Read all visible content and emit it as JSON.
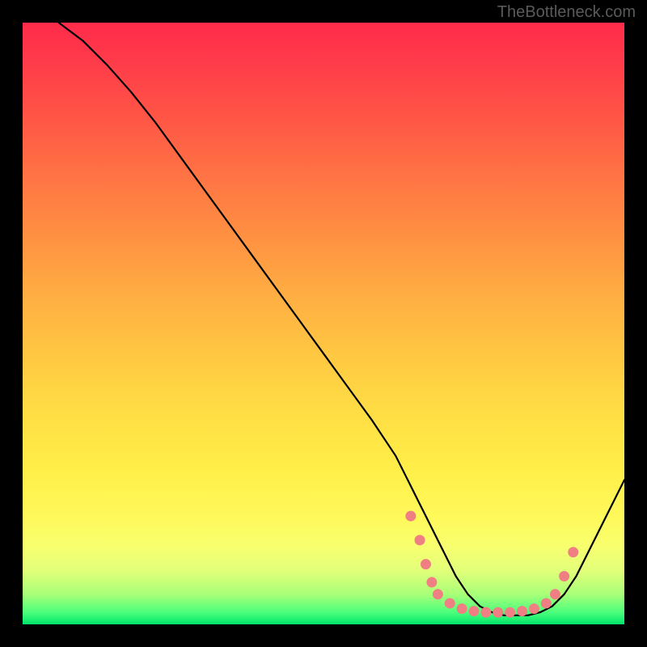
{
  "attribution": "TheBottleneck.com",
  "chart_data": {
    "type": "line",
    "title": "",
    "xlabel": "",
    "ylabel": "",
    "xlim": [
      0,
      100
    ],
    "ylim": [
      0,
      100
    ],
    "series": [
      {
        "name": "bottleneck-curve",
        "x": [
          6,
          10,
          14,
          18,
          22,
          26,
          30,
          34,
          38,
          42,
          46,
          50,
          54,
          58,
          62,
          64,
          66,
          68,
          70,
          72,
          74,
          76,
          78,
          80,
          82,
          84,
          86,
          88,
          90,
          92,
          94,
          96,
          98,
          100
        ],
        "y": [
          100,
          97,
          93,
          88.5,
          83.5,
          78,
          72.5,
          67,
          61.5,
          56,
          50.5,
          45,
          39.5,
          34,
          28,
          24,
          20,
          16,
          12,
          8,
          5,
          3,
          2,
          1.5,
          1.5,
          1.5,
          2,
          3,
          5,
          8,
          12,
          16,
          20,
          24
        ]
      }
    ],
    "markers": {
      "name": "highlight-points",
      "color": "#ef7f83",
      "points": [
        {
          "x": 64.5,
          "y": 18
        },
        {
          "x": 66,
          "y": 14
        },
        {
          "x": 67,
          "y": 10
        },
        {
          "x": 68,
          "y": 7
        },
        {
          "x": 69,
          "y": 5
        },
        {
          "x": 71,
          "y": 3.5
        },
        {
          "x": 73,
          "y": 2.6
        },
        {
          "x": 75,
          "y": 2.2
        },
        {
          "x": 77,
          "y": 2
        },
        {
          "x": 79,
          "y": 2
        },
        {
          "x": 81,
          "y": 2
        },
        {
          "x": 83,
          "y": 2.2
        },
        {
          "x": 85,
          "y": 2.6
        },
        {
          "x": 87,
          "y": 3.5
        },
        {
          "x": 88.5,
          "y": 5
        },
        {
          "x": 90,
          "y": 8
        },
        {
          "x": 91.5,
          "y": 12
        }
      ]
    }
  }
}
